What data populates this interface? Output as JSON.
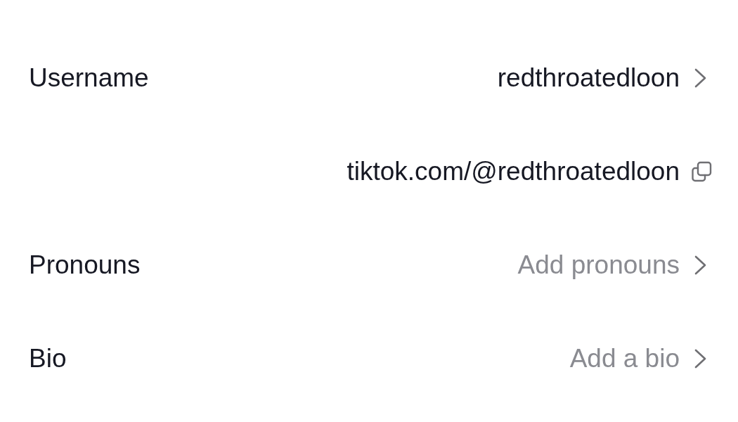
{
  "rows": [
    {
      "kind": "nav",
      "label": "Username",
      "value": "redthroatedloon"
    },
    {
      "kind": "copy",
      "value": "tiktok.com/@redthroatedloon"
    },
    {
      "kind": "nav",
      "label": "Pronouns",
      "placeholder": "Add pronouns"
    },
    {
      "kind": "nav",
      "label": "Bio",
      "placeholder": "Add a bio"
    }
  ]
}
